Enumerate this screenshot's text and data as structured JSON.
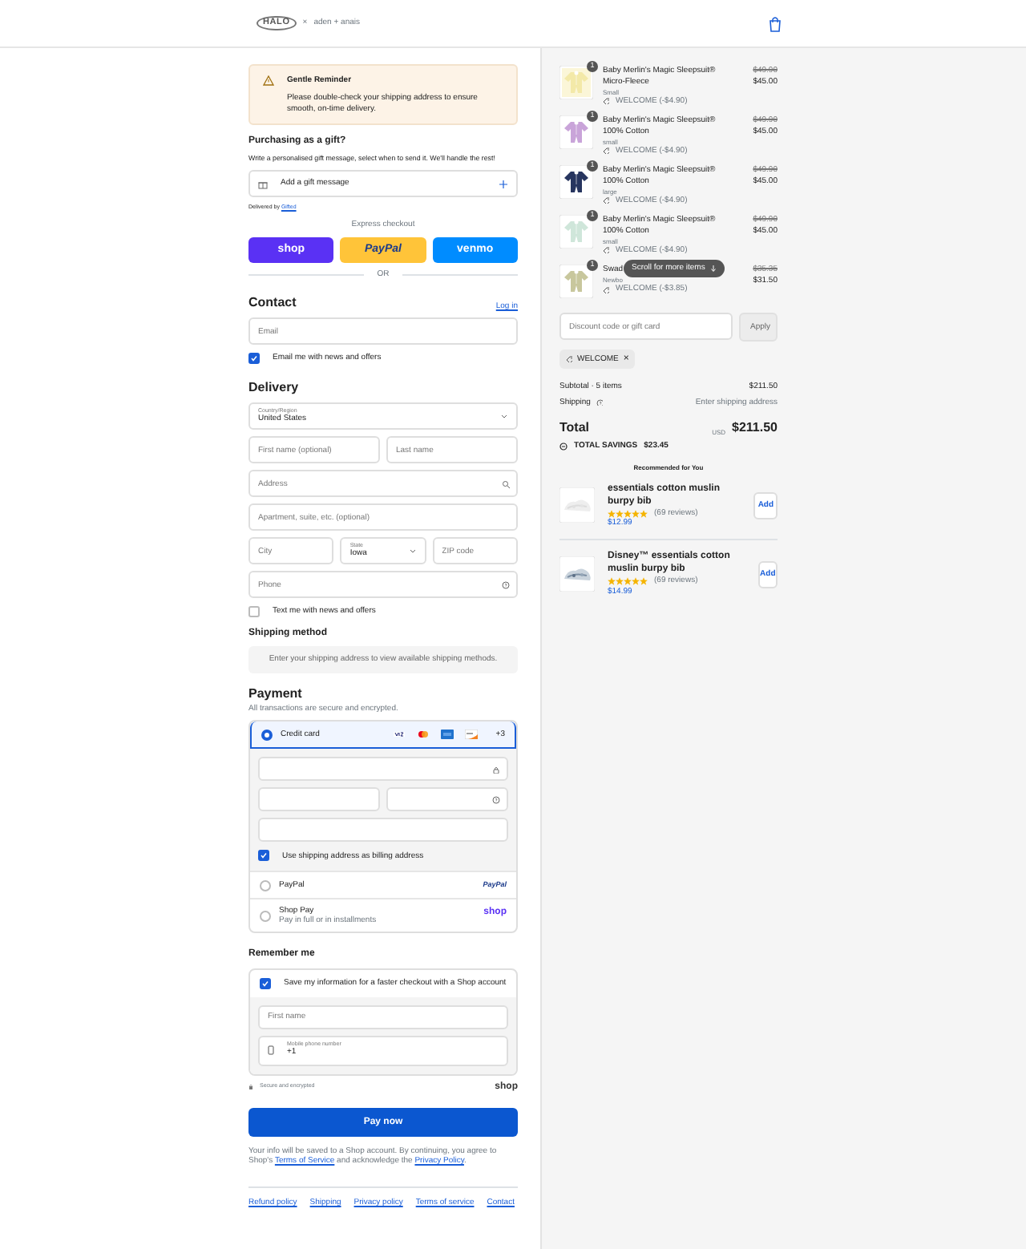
{
  "header": {
    "logo": "HALO",
    "separator": "×",
    "partner": "aden + anais"
  },
  "reminder": {
    "title": "Gentle Reminder",
    "text": "Please double-check your shipping address to ensure smooth, on-time delivery."
  },
  "gift": {
    "title": "Purchasing as a gift?",
    "subtitle": "Write a personalised gift message, select when to send it. We'll handle the rest!",
    "field": "Add a gift message",
    "delivered_by": "Delivered by",
    "delivered_link": "Gifted"
  },
  "express": {
    "title": "Express checkout",
    "buttons": [
      {
        "kind": "shop",
        "label": "shop"
      },
      {
        "kind": "paypal",
        "label": "PayPal"
      },
      {
        "kind": "venmo",
        "label": "venmo"
      }
    ],
    "divider": "OR"
  },
  "contact": {
    "title": "Contact",
    "login": "Log in",
    "email_placeholder": "Email",
    "news": {
      "label": "Email me with news and offers",
      "checked": true
    }
  },
  "delivery": {
    "title": "Delivery",
    "rows": [
      [
        {
          "kind": "select",
          "label": "Country/Region",
          "value": "United States"
        }
      ],
      [
        {
          "kind": "text",
          "placeholder": "First name (optional)"
        },
        {
          "kind": "text",
          "placeholder": "Last name"
        }
      ],
      [
        {
          "kind": "search",
          "placeholder": "Address"
        }
      ],
      [
        {
          "kind": "text",
          "placeholder": "Apartment, suite, etc. (optional)"
        }
      ],
      [
        {
          "kind": "text",
          "placeholder": "City"
        },
        {
          "kind": "select",
          "label": "State",
          "value": "Iowa"
        },
        {
          "kind": "text",
          "placeholder": "ZIP code"
        }
      ],
      [
        {
          "kind": "help",
          "placeholder": "Phone"
        }
      ]
    ],
    "sms": {
      "label": "Text me with news and offers",
      "checked": false
    }
  },
  "shipping": {
    "title": "Shipping method",
    "note": "Enter your shipping address to view available shipping methods."
  },
  "payment": {
    "title": "Payment",
    "subtitle": "All transactions are secure and encrypted.",
    "methods": [
      {
        "kind": "card",
        "label": "Credit card",
        "selected": true,
        "more": "+3",
        "billing": {
          "label": "Use shipping address as billing address",
          "checked": true
        }
      },
      {
        "kind": "paypal",
        "label": "PayPal",
        "selected": false,
        "logo": "PayPal"
      },
      {
        "kind": "shop",
        "label": "Shop Pay",
        "sublabel": "Pay in full or in installments",
        "selected": false,
        "logo": "shop"
      }
    ]
  },
  "remember": {
    "title": "Remember me",
    "save": {
      "label": "Save my information for a faster checkout with a Shop account",
      "checked": true
    },
    "first_name_placeholder": "First name",
    "phone_label": "Mobile phone number",
    "phone_value": "+1",
    "secure": "Secure and encrypted",
    "shop_logo": "shop"
  },
  "pay_button": "Pay now",
  "legal": {
    "before": "Your info will be saved to a Shop account. By continuing, you agree to Shop's",
    "terms": "Terms of Service",
    "middle": "and acknowledge the",
    "privacy": "Privacy Policy",
    "after": "."
  },
  "footer_links": [
    "Refund policy",
    "Shipping",
    "Privacy policy",
    "Terms of service",
    "Contact"
  ],
  "cart": {
    "items": [
      {
        "quantity": "1",
        "name": "Baby Merlin's Magic Sleepsuit® Micro-Fleece",
        "variant": "Small",
        "discount": "WELCOME (-$4.90)",
        "original_price": "$49.90",
        "price": "$45.00"
      },
      {
        "quantity": "1",
        "name": "Baby Merlin's Magic Sleepsuit® 100% Cotton",
        "variant": "small",
        "discount": "WELCOME (-$4.90)",
        "original_price": "$49.90",
        "price": "$45.00"
      },
      {
        "quantity": "1",
        "name": "Baby Merlin's Magic Sleepsuit® 100% Cotton",
        "variant": "large",
        "discount": "WELCOME (-$4.90)",
        "original_price": "$49.90",
        "price": "$45.00"
      },
      {
        "quantity": "1",
        "name": "Baby Merlin's Magic Sleepsuit® 100% Cotton",
        "variant": "small",
        "discount": "WELCOME (-$4.90)",
        "original_price": "$49.90",
        "price": "$45.00"
      },
      {
        "quantity": "1",
        "name": "Swad",
        "variant": "Newbo",
        "discount": "WELCOME (-$3.85)",
        "original_price": "$35.35",
        "price": "$31.50"
      }
    ],
    "scroll_hint": "Scroll for more items"
  },
  "discount": {
    "placeholder": "Discount code or gift card",
    "button": "Apply",
    "applied": "WELCOME",
    "remove": "×"
  },
  "summary": {
    "subtotal_label": "Subtotal · 5 items",
    "subtotal": "$211.50",
    "shipping_label": "Shipping",
    "shipping": "Enter shipping address",
    "total_label": "Total",
    "currency": "USD",
    "total": "$211.50",
    "savings_label": "TOTAL SAVINGS",
    "savings": "$23.45"
  },
  "recommended": {
    "title": "Recommended for You",
    "items": [
      {
        "name": "essentials cotton muslin burpy bib",
        "stars": 5,
        "reviews": "(69 reviews)",
        "price": "$12.99",
        "button": "Add"
      },
      {
        "name": "Disney™ essentials cotton muslin burpy bib",
        "stars": 5,
        "reviews": "(69 reviews)",
        "price": "$14.99",
        "button": "Add"
      }
    ]
  }
}
